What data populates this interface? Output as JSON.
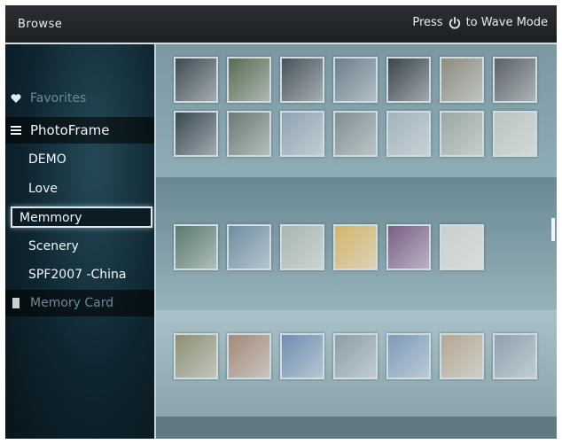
{
  "header": {
    "title": "Browse",
    "hint_press": "Press",
    "hint_rest": "to Wave Mode",
    "hint_icon": "power-icon"
  },
  "sidebar": {
    "items": [
      {
        "label": "Favorites",
        "icon": "heart-icon",
        "state": "dim"
      },
      {
        "label": "PhotoFrame",
        "icon": "list-icon",
        "state": "root"
      },
      {
        "label": "DEMO",
        "state": "normal"
      },
      {
        "label": "Love",
        "state": "normal"
      },
      {
        "label": "Memmory",
        "state": "selected"
      },
      {
        "label": "Scenery",
        "state": "normal"
      },
      {
        "label": "SPF2007 -China",
        "state": "normal"
      },
      {
        "label": "Memory Card",
        "icon": "card-icon",
        "state": "dim"
      }
    ]
  },
  "thumbnails": {
    "row1": [
      "#3e4a52",
      "#5b6b55",
      "#48525a",
      "#6b7f8c",
      "#3a444b",
      "#8a8c7f",
      "#5a6168"
    ],
    "row2": [
      "#394850",
      "#6a7a75",
      "#8fa3b1",
      "#7f8e93",
      "#a1b2bb",
      "#9ba7a4",
      "#b9c4bf"
    ],
    "row3": [
      "#5a7a6e",
      "#6e8da1",
      "#a9b6ad",
      "#d4b46a",
      "#7b5e86",
      "#c8cfcb"
    ],
    "row4": [
      "#8d8f72",
      "#a38a7a",
      "#6f8fb0",
      "#8c9ea7",
      "#7e9bb8",
      "#b4a793",
      "#8ea1ae"
    ]
  },
  "colors": {
    "selection_border": "#dfe9ee",
    "background": "#0b1a21"
  }
}
